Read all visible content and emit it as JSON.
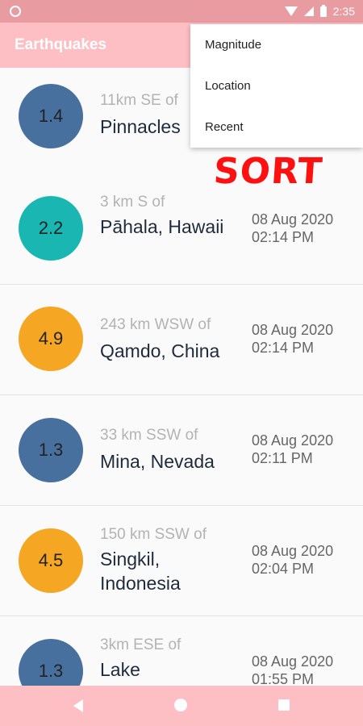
{
  "status_bar": {
    "time": "2:35"
  },
  "app_bar": {
    "title": "Earthquakes"
  },
  "sort_menu": {
    "items": [
      {
        "label": "Magnitude"
      },
      {
        "label": "Location"
      },
      {
        "label": "Recent"
      }
    ]
  },
  "badge": {
    "text": "SORT",
    "color": "#ff1010"
  },
  "quakes": [
    {
      "magnitude": "1.4",
      "offset": "11km SE of",
      "place": "Pinnacles",
      "date": "",
      "time": "",
      "color": "#48709f"
    },
    {
      "magnitude": "2.2",
      "offset": "3 km S of",
      "place": "Pāhala, Hawaii",
      "date": "08 Aug 2020",
      "time": "02:14 PM",
      "color": "#1ab7b2"
    },
    {
      "magnitude": "4.9",
      "offset": "243 km WSW of",
      "place": "Qamdo, China",
      "date": "08 Aug 2020",
      "time": "02:14 PM",
      "color": "#f5a623"
    },
    {
      "magnitude": "1.3",
      "offset": "33 km SSW of",
      "place": "Mina, Nevada",
      "date": "08 Aug 2020",
      "time": "02:11 PM",
      "color": "#48709f"
    },
    {
      "magnitude": "4.5",
      "offset": "150 km SSW of",
      "place": "Singkil, Indonesia",
      "date": "08 Aug 2020",
      "time": "02:04 PM",
      "color": "#f5a623"
    },
    {
      "magnitude": "1.3",
      "offset": "3km ESE of",
      "place": "Lake",
      "date": "08 Aug 2020",
      "time": "01:55 PM",
      "color": "#48709f"
    }
  ],
  "nav_bar": {
    "back_icon": "back-triangle",
    "home_icon": "home-circle",
    "recents_icon": "recents-square"
  }
}
